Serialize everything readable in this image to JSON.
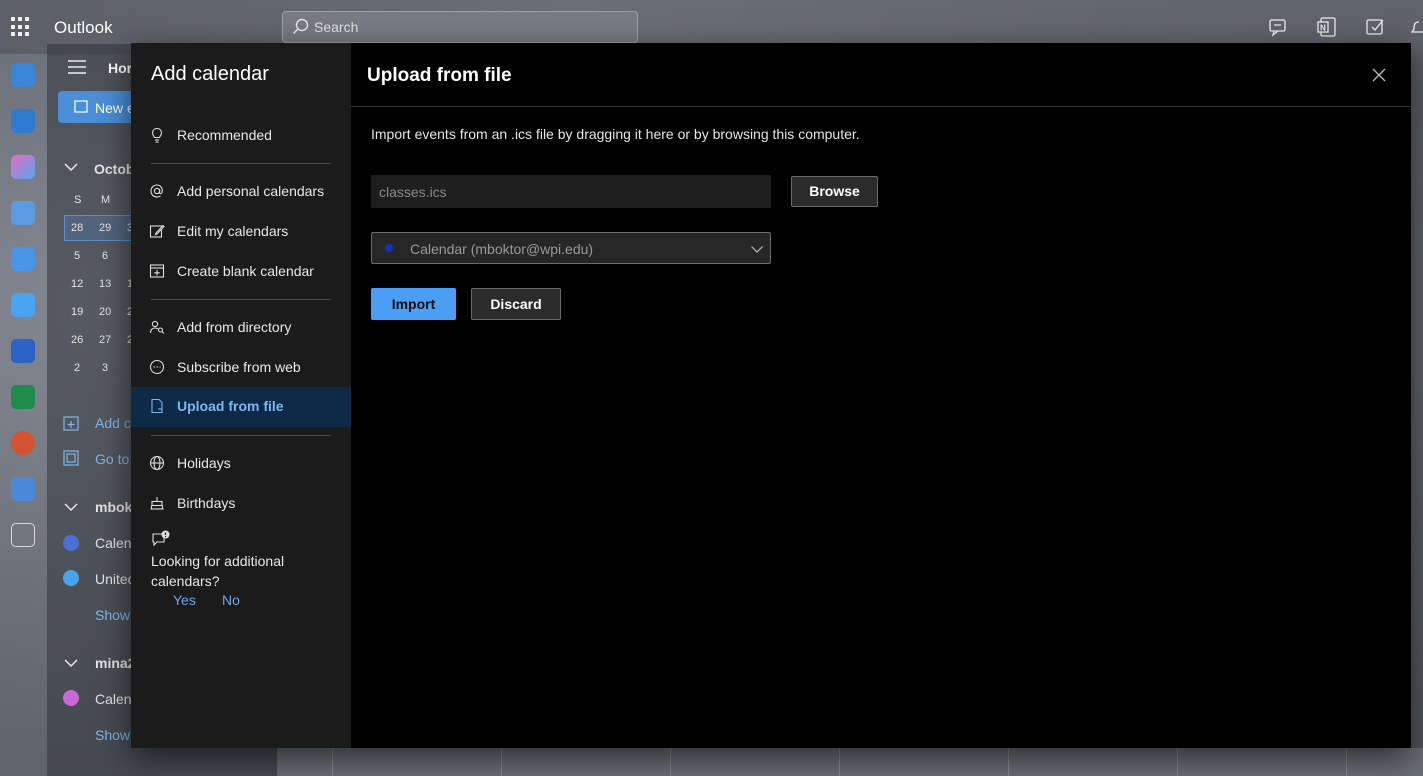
{
  "app": {
    "title": "Outlook"
  },
  "search": {
    "placeholder": "Search"
  },
  "background": {
    "tab_partial": "Hor",
    "new_event_partial": "New e",
    "month_partial": "Octob",
    "weekday_headers": [
      "S",
      "M"
    ],
    "mini_calendar_rows": [
      [
        "28",
        "29",
        "3"
      ],
      [
        "5",
        "6",
        ""
      ],
      [
        "12",
        "13",
        "1"
      ],
      [
        "19",
        "20",
        "2"
      ],
      [
        "26",
        "27",
        "2"
      ],
      [
        "2",
        "3",
        ""
      ]
    ],
    "add_calendar_partial": "Add c",
    "go_to_partial": "Go to",
    "account1_partial": "mbok",
    "account1_items": [
      "Calen",
      "Unitec"
    ],
    "show_more_partial": "Show",
    "account2_partial": "mina2",
    "account2_items": [
      "Calen"
    ],
    "show_more_partial_2": "Show"
  },
  "modal": {
    "nav_title": "Add calendar",
    "nav_items": [
      {
        "label": "Recommended",
        "icon": "lightbulb-icon"
      },
      {
        "label": "Add personal calendars",
        "icon": "at-sign-icon"
      },
      {
        "label": "Edit my calendars",
        "icon": "edit-icon"
      },
      {
        "label": "Create blank calendar",
        "icon": "calendar-add-icon"
      },
      {
        "label": "Add from directory",
        "icon": "people-search-icon"
      },
      {
        "label": "Subscribe from web",
        "icon": "link-icon"
      },
      {
        "label": "Upload from file",
        "icon": "document-icon",
        "active": true
      },
      {
        "label": "Holidays",
        "icon": "globe-icon"
      },
      {
        "label": "Birthdays",
        "icon": "cake-icon"
      }
    ],
    "feedback": {
      "question": "Looking for additional calendars?",
      "yes": "Yes",
      "no": "No"
    },
    "main": {
      "title": "Upload from file",
      "description": "Import events from an .ics file by dragging it here or by browsing this computer.",
      "file_value": "classes.ics",
      "browse_label": "Browse",
      "calendar_select": "Calendar (mboktor@wpi.edu)",
      "import_label": "Import",
      "discard_label": "Discard"
    }
  },
  "colors": {
    "accent": "#4a9ff5",
    "active_nav_bg": "#0f2a47",
    "calendar_dot": "#1a2fbf",
    "link": "#6ea8e8"
  }
}
